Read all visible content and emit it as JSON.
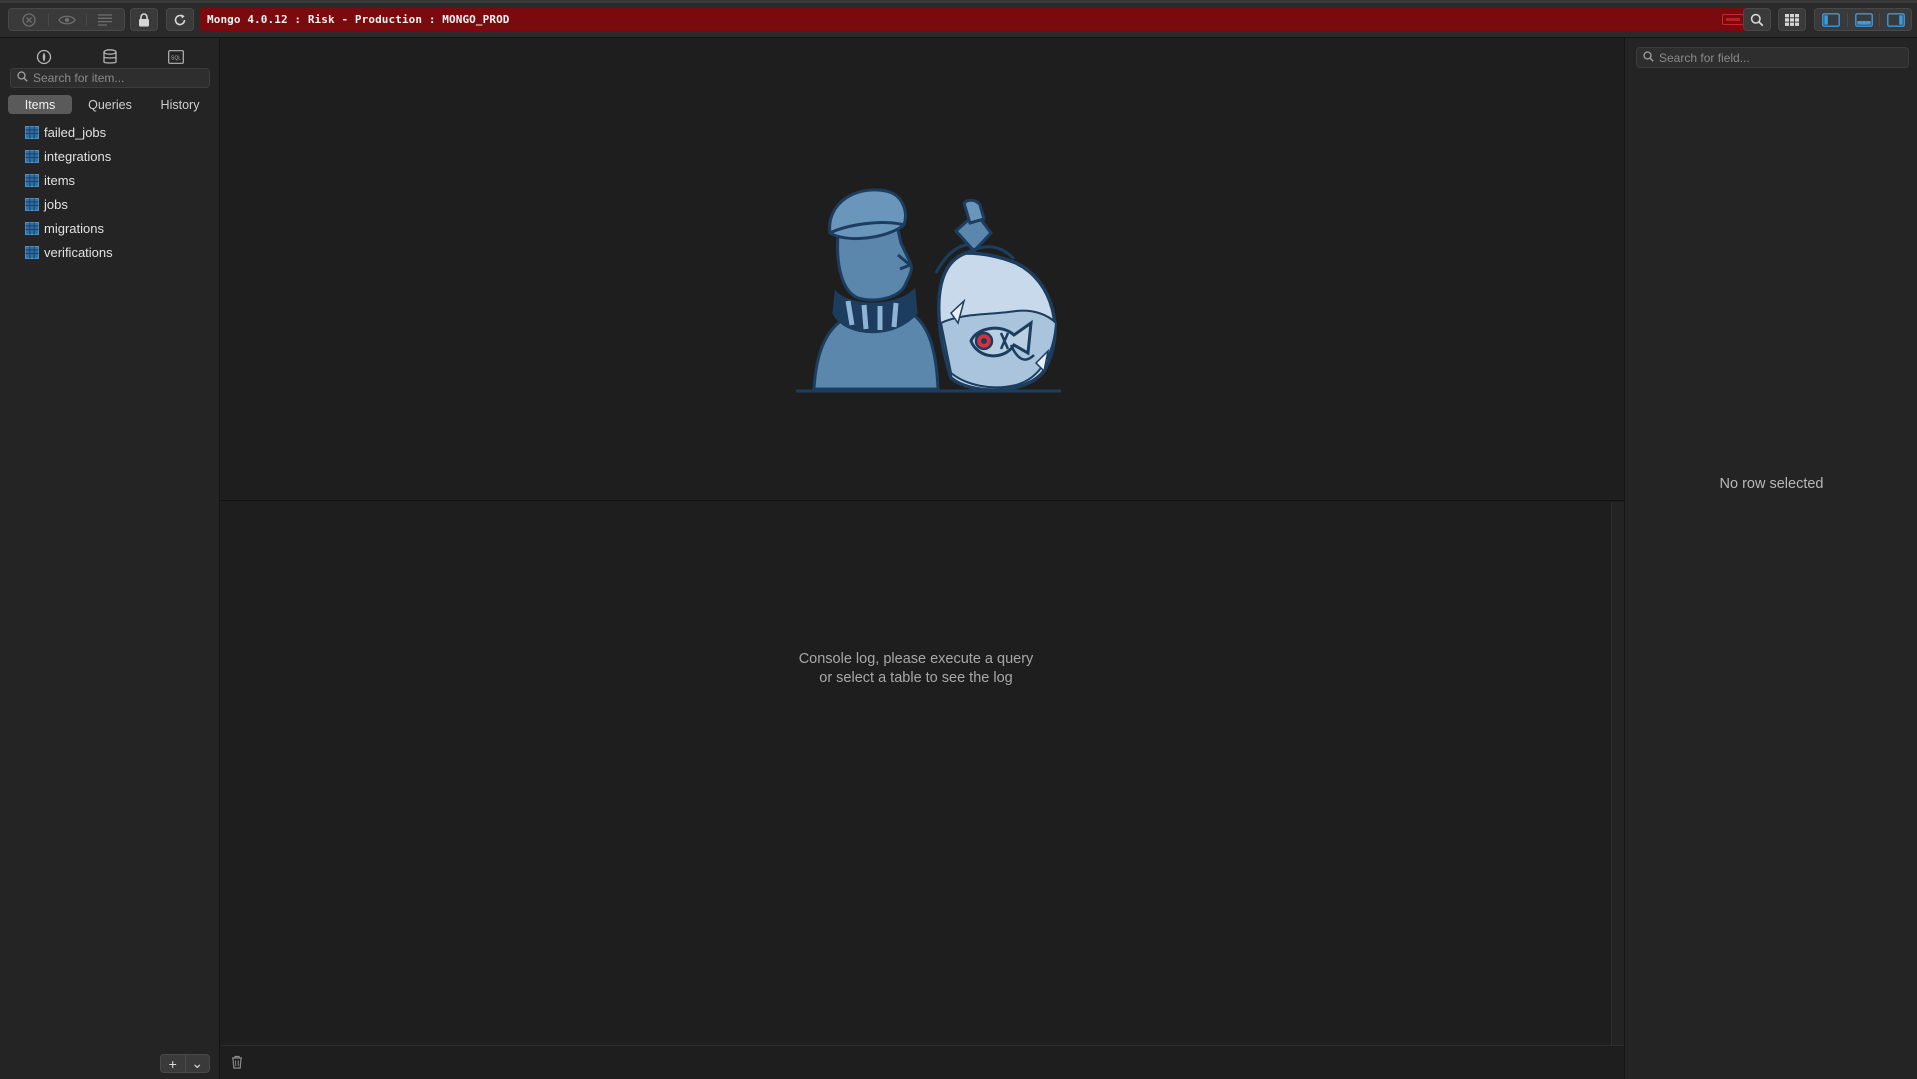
{
  "toolbar": {
    "connection_title": "Mongo 4.0.12 : Risk - Production : MONGO_PROD",
    "env_color": "#7a0a0d",
    "buttons_left": [
      "close-circle-icon",
      "eye-icon",
      "list-icon",
      "lock-icon",
      "refresh-icon"
    ],
    "buttons_right": [
      "search-icon",
      "grid-icon",
      "layout-left-icon",
      "layout-bottom-icon",
      "layout-right-icon"
    ]
  },
  "sidebar": {
    "icons": [
      "connection-icon",
      "database-icon",
      "sql-icon"
    ],
    "sql_label": "SQL",
    "search_placeholder": "Search for item...",
    "tabs": [
      {
        "label": "Items",
        "active": true
      },
      {
        "label": "Queries",
        "active": false
      },
      {
        "label": "History",
        "active": false
      }
    ],
    "items": [
      {
        "label": "failed_jobs"
      },
      {
        "label": "integrations"
      },
      {
        "label": "items"
      },
      {
        "label": "jobs"
      },
      {
        "label": "migrations"
      },
      {
        "label": "verifications"
      }
    ],
    "footer": {
      "add_label": "+",
      "menu_label": "⌄"
    }
  },
  "console": {
    "message_line1": "Console log, please execute a query",
    "message_line2": "or select a table to see the log"
  },
  "right_panel": {
    "search_placeholder": "Search for field...",
    "empty_message": "No row selected"
  },
  "colors": {
    "accent": "#3a8fd4",
    "illustration": "#5b87ad",
    "danger": "#c9272d"
  }
}
